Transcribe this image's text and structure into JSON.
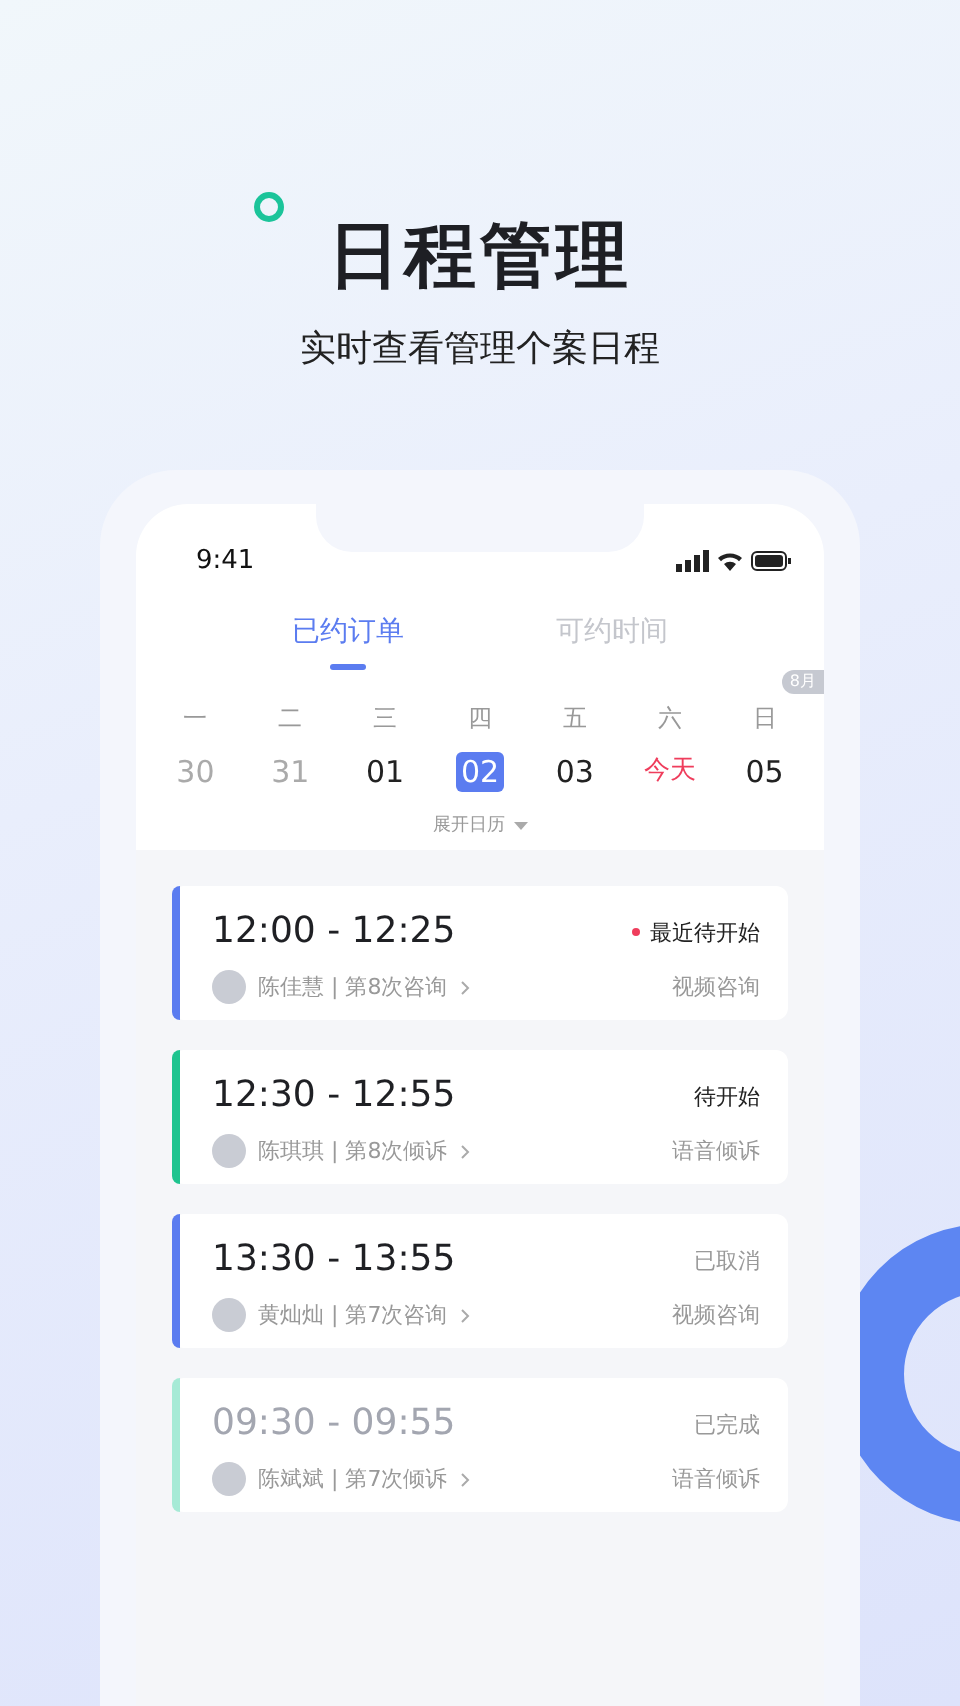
{
  "header": {
    "title": "日程管理",
    "subtitle": "实时查看管理个案日程"
  },
  "status_bar": {
    "time": "9:41"
  },
  "tabs": [
    {
      "label": "已约订单",
      "selected": true
    },
    {
      "label": "可约时间",
      "selected": false
    }
  ],
  "month_badge": "8月",
  "week": [
    {
      "weekday": "一",
      "date": "30",
      "kind": "past",
      "selected": false
    },
    {
      "weekday": "二",
      "date": "31",
      "kind": "past",
      "selected": false
    },
    {
      "weekday": "三",
      "date": "01",
      "kind": "normal",
      "selected": false
    },
    {
      "weekday": "四",
      "date": "02",
      "kind": "normal",
      "selected": true
    },
    {
      "weekday": "五",
      "date": "03",
      "kind": "normal",
      "selected": false
    },
    {
      "weekday": "六",
      "date": "今天",
      "kind": "today",
      "selected": false
    },
    {
      "weekday": "日",
      "date": "05",
      "kind": "normal",
      "selected": false
    }
  ],
  "expand_label": "展开日历",
  "appointments": [
    {
      "time": "12:00 - 12:25",
      "status": "最近待开始",
      "kind": "upcoming",
      "client": "陈佳慧 | 第8次咨询",
      "type": "视频咨询",
      "color": "#5b7cf0"
    },
    {
      "time": "12:30 - 12:55",
      "status": "待开始",
      "kind": "pending",
      "client": "陈琪琪 | 第8次倾诉",
      "type": "语音倾诉",
      "color": "#1fc48f"
    },
    {
      "time": "13:30 - 13:55",
      "status": "已取消",
      "kind": "cancelled",
      "client": "黄灿灿 | 第7次咨询",
      "type": "视频咨询",
      "color": "#5b7cf0"
    },
    {
      "time": "09:30 - 09:55",
      "status": "已完成",
      "kind": "done",
      "client": "陈斌斌 | 第7次倾诉",
      "type": "语音倾诉",
      "color": "#a6ead6"
    }
  ]
}
